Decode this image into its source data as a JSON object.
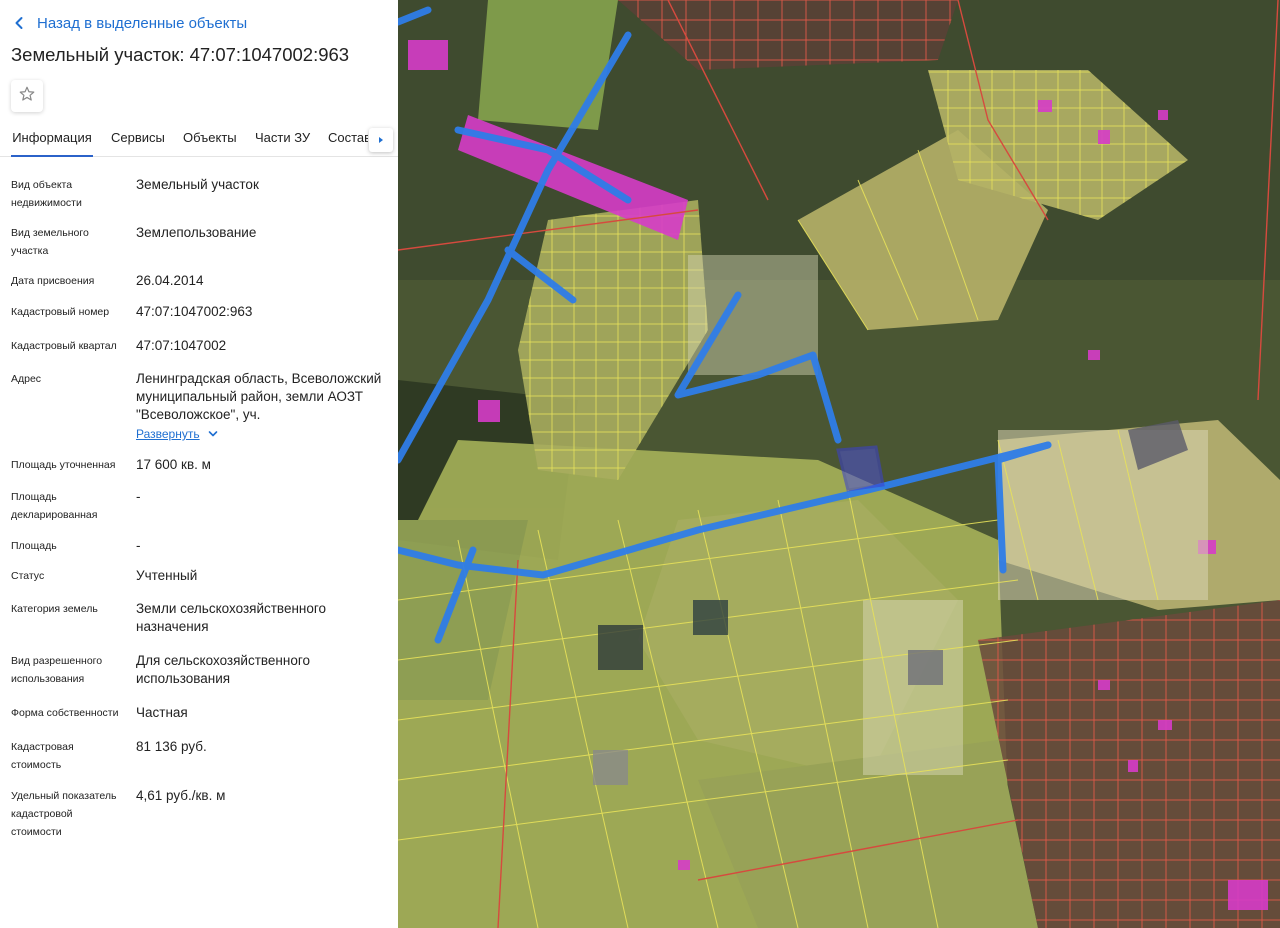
{
  "nav": {
    "back_label": "Назад в выделенные объекты"
  },
  "header": {
    "title": "Земельный участок: 47:07:1047002:963"
  },
  "tabs": [
    {
      "label": "Информация",
      "active": true
    },
    {
      "label": "Сервисы",
      "active": false
    },
    {
      "label": "Объекты",
      "active": false
    },
    {
      "label": "Части ЗУ",
      "active": false
    },
    {
      "label": "Состав",
      "active": false
    }
  ],
  "info": [
    {
      "label": "Вид объекта недвижимости",
      "value": "Земельный участок"
    },
    {
      "label": "Вид земельного участка",
      "value": "Землепользование"
    },
    {
      "label": "Дата присвоения",
      "value": "26.04.2014"
    },
    {
      "label": "Кадастровый номер",
      "value": "47:07:1047002:963"
    },
    {
      "label": "Кадастровый квартал",
      "value": "47:07:1047002"
    },
    {
      "label": "Адрес",
      "value": "Ленинградская область, Всеволожский муниципальный район, земли АОЗТ \"Всеволожское\", уч."
    },
    {
      "label": "Площадь уточненная",
      "value": "17 600 кв. м"
    },
    {
      "label": "Площадь декларированная",
      "value": "-"
    },
    {
      "label": "Площадь",
      "value": "-"
    },
    {
      "label": "Статус",
      "value": "Учтенный"
    },
    {
      "label": "Категория земель",
      "value": "Земли сельскохозяйственного назначения"
    },
    {
      "label": "Вид разрешенного использования",
      "value": "Для сельскохозяйственного использования"
    },
    {
      "label": "Форма собственности",
      "value": "Частная"
    },
    {
      "label": "Кадастровая стоимость",
      "value": "81 136 руб."
    },
    {
      "label": "Удельный показатель кадастровой стоимости",
      "value": "4,61 руб./кв. м"
    }
  ],
  "address_expand_label": "Развернуть",
  "colors": {
    "link": "#1f6fd1",
    "tab_active": "#2b62c9",
    "map_road": "#2f7de8",
    "map_parcel_outline": "#e8e25a",
    "map_built_parcel": "#d63cc8",
    "map_selected_parcel": "#3a3fd0"
  },
  "icons": {
    "back": "chevron-left-icon",
    "favorite": "star-outline-icon",
    "tabs_scroll": "caret-right-icon",
    "expand": "chevron-down-icon"
  }
}
